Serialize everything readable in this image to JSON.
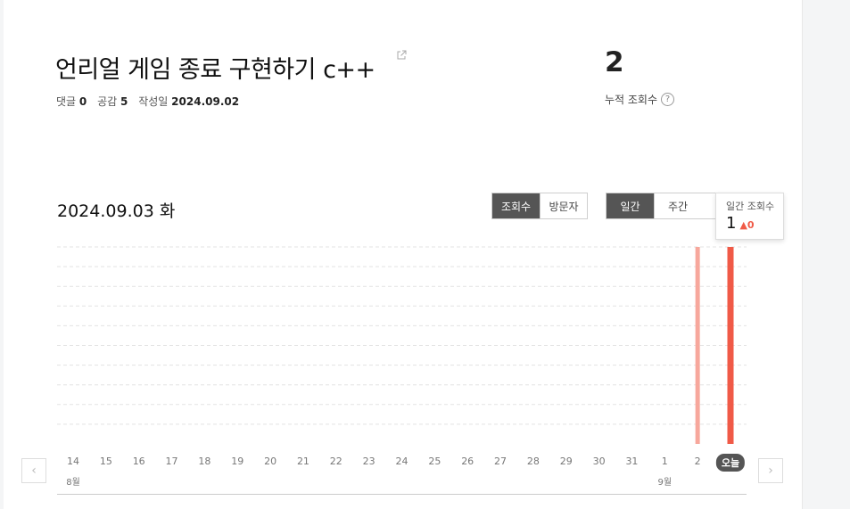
{
  "post": {
    "title": "언리얼 게임 종료 구현하기 c++",
    "comments_label": "댓글",
    "comments_count": "0",
    "likes_label": "공감",
    "likes_count": "5",
    "created_label": "작성일",
    "created_date": "2024.09.02"
  },
  "summary": {
    "total_views": "2",
    "total_label": "누적 조회수",
    "help": "?"
  },
  "stats": {
    "date_heading": "2024.09.03 화",
    "metric_tabs": [
      "조회수",
      "방문자"
    ],
    "metric_active": 0,
    "period_tabs": [
      "일간",
      "주간"
    ],
    "period_active": 0,
    "tooltip": {
      "label": "일간 조회수",
      "value": "1",
      "delta_icon": "up-triangle-icon",
      "delta": "0"
    },
    "nav": {
      "prev": "‹",
      "next": "›"
    }
  },
  "colors": {
    "accent": "#f05a47",
    "accent_light": "#f7a79c",
    "active_tab": "#555555"
  },
  "chart_data": {
    "type": "bar",
    "categories": [
      "14",
      "15",
      "16",
      "17",
      "18",
      "19",
      "20",
      "21",
      "22",
      "23",
      "24",
      "25",
      "26",
      "27",
      "28",
      "29",
      "30",
      "31",
      "1",
      "2",
      "오늘"
    ],
    "values": [
      0,
      0,
      0,
      0,
      0,
      0,
      0,
      0,
      0,
      0,
      0,
      0,
      0,
      0,
      0,
      0,
      0,
      0,
      0,
      1,
      1
    ],
    "month_labels": [
      {
        "index": 0,
        "label": "8월"
      },
      {
        "index": 18,
        "label": "9월"
      }
    ],
    "highlight_index": 20,
    "ylim": [
      0,
      1
    ],
    "grid": true,
    "title": "",
    "xlabel": "",
    "ylabel": ""
  }
}
